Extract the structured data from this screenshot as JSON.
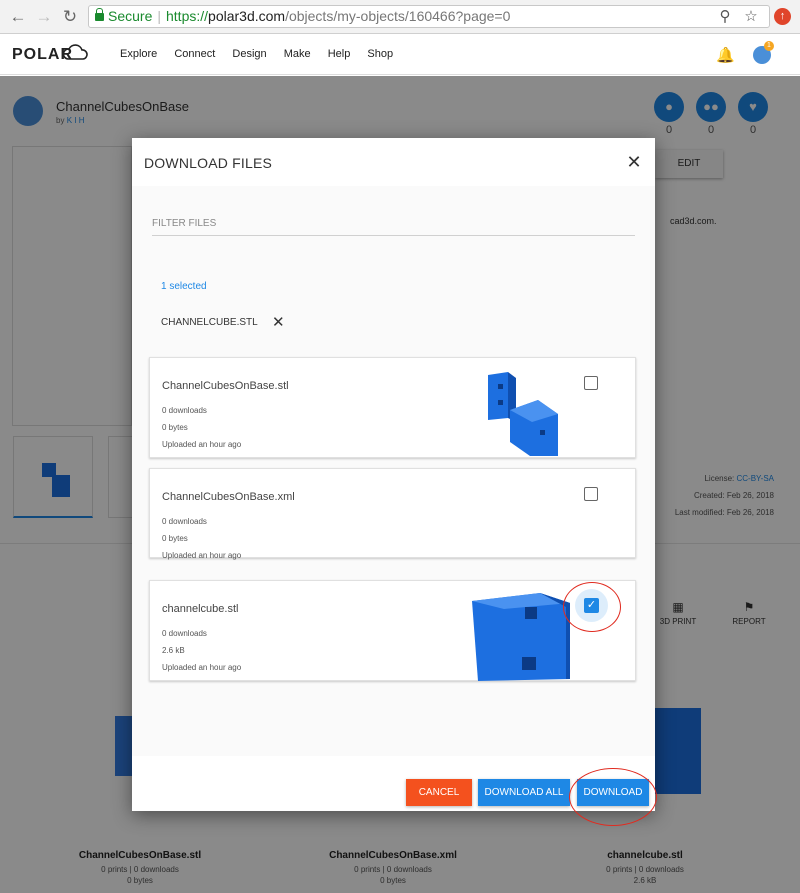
{
  "browser": {
    "secure_label": "Secure",
    "url_https": "https://",
    "url_host": "polar3d.com",
    "url_path": "/objects/my-objects/160466?page=0"
  },
  "site": {
    "logo": "POLAR",
    "menu": [
      "Explore",
      "Connect",
      "Design",
      "Make",
      "Help",
      "Shop"
    ],
    "notification_count": "1"
  },
  "object": {
    "title": "ChannelCubesOnBase",
    "by_prefix": "by",
    "author": "K I H",
    "stats": [
      "0",
      "0",
      "0"
    ],
    "edit_label": "EDIT",
    "license_label": "License:",
    "license_value": "CC-BY-SA",
    "created": "Created: Feb 26, 2018",
    "modified": "Last modified: Feb 26, 2018",
    "desc_fragment": "cad3d.com.",
    "actions": [
      "3D PRINT",
      "REPORT"
    ],
    "cards": [
      {
        "name": "ChannelCubesOnBase.stl",
        "prints": "0 prints | 0 downloads",
        "size": "0 bytes"
      },
      {
        "name": "ChannelCubesOnBase.xml",
        "prints": "0 prints | 0 downloads",
        "size": "0 bytes"
      },
      {
        "name": "channelcube.stl",
        "prints": "0 prints | 0 downloads",
        "size": "2.6 kB"
      }
    ]
  },
  "modal": {
    "title": "DOWNLOAD FILES",
    "filter_placeholder": "FILTER FILES",
    "selected_count": "1 selected",
    "chip": "CHANNELCUBE.STL",
    "files": [
      {
        "name": "ChannelCubesOnBase.stl",
        "downloads": "0 downloads",
        "size": "0 bytes",
        "uploaded": "Uploaded an hour ago",
        "checked": false
      },
      {
        "name": "ChannelCubesOnBase.xml",
        "downloads": "0 downloads",
        "size": "0 bytes",
        "uploaded": "Uploaded an hour ago",
        "checked": false
      },
      {
        "name": "channelcube.stl",
        "downloads": "0 downloads",
        "size": "2.6 kB",
        "uploaded": "Uploaded an hour ago",
        "checked": true
      }
    ],
    "buttons": {
      "cancel": "CANCEL",
      "download_all": "DOWNLOAD ALL",
      "download": "DOWNLOAD"
    }
  },
  "colors": {
    "accent": "#1e88e5",
    "cancel": "#f4511e",
    "annotation": "#e02b20"
  }
}
